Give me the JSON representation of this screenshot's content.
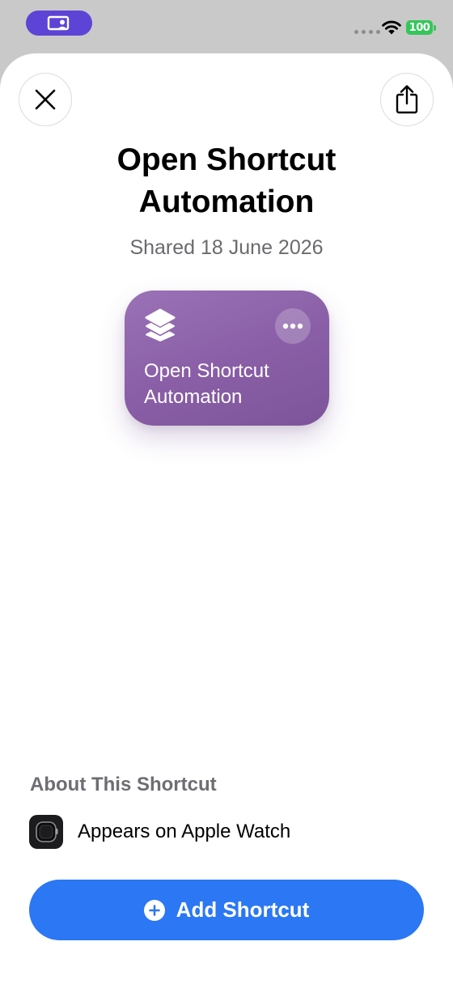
{
  "colors": {
    "screen_pill": "#5d44d6",
    "battery_fill": "#34c759",
    "card_gradient_top": "#9a72b6",
    "card_gradient_bottom": "#7d5499",
    "add_button": "#2b77f4"
  },
  "status_bar": {
    "battery_level": "100",
    "icons": [
      "screen-sharing-icon",
      "signal-dots-icon",
      "wifi-icon",
      "battery-icon"
    ]
  },
  "sheet": {
    "close_icon": "close-icon",
    "share_icon": "share-icon",
    "title": "Open Shortcut Automation",
    "shared_date": "Shared 18 June 2026"
  },
  "card": {
    "icon": "layers-icon",
    "more_icon": "ellipsis-icon",
    "name": "Open Shortcut Automation"
  },
  "about": {
    "heading": "About This Shortcut",
    "rows": [
      {
        "icon": "apple-watch-icon",
        "text": "Appears on Apple Watch"
      }
    ]
  },
  "add_button": {
    "icon": "plus-circle-icon",
    "label": "Add Shortcut"
  }
}
